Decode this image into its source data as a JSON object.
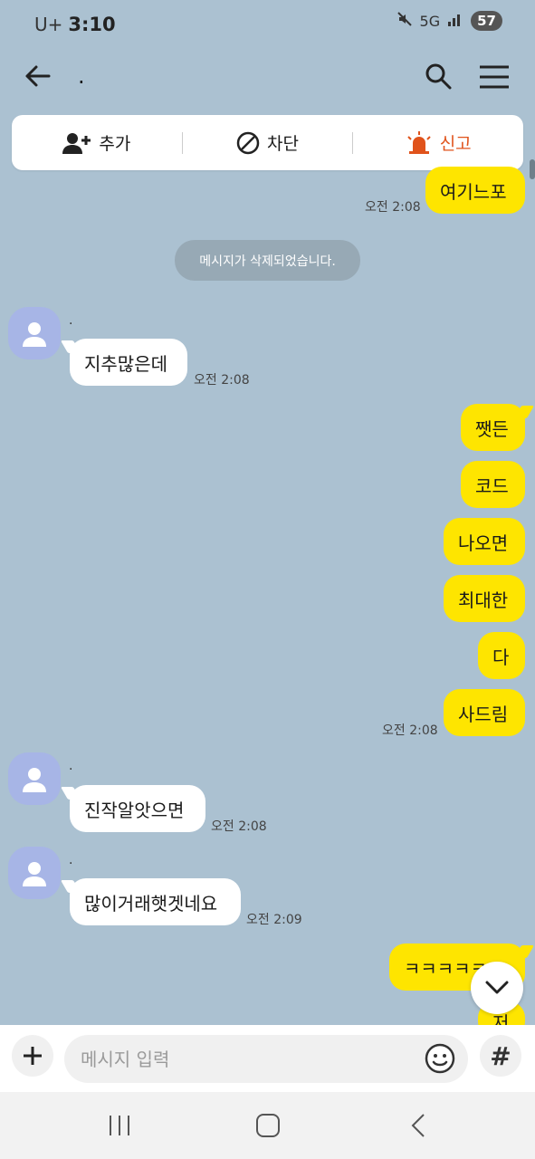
{
  "status_bar": {
    "carrier": "U+",
    "time": "3:10",
    "network": "5G",
    "battery": "57"
  },
  "header": {
    "title": "."
  },
  "actions": {
    "add": "추가",
    "block": "차단",
    "report": "신고"
  },
  "system_message": "메시지가 삭제되었습니다.",
  "messages": [
    {
      "text": "여기느포"
    },
    {
      "time": "오전 2:08"
    },
    {
      "sender": ".",
      "text": "지추많은데",
      "time": "오전 2:08"
    },
    {
      "text": "쨋든"
    },
    {
      "text": "코드"
    },
    {
      "text": "나오면"
    },
    {
      "text": "최대한"
    },
    {
      "text": "다"
    },
    {
      "text": "사드림",
      "time": "오전 2:08"
    },
    {
      "sender": ".",
      "text": "진작알앗으면",
      "time": "오전 2:08"
    },
    {
      "sender": ".",
      "text": "많이거래햇겟네요",
      "time": "오전 2:09"
    },
    {
      "text": "ㅋㅋㅋㅋㅋㅋ"
    },
    {
      "text": "저"
    }
  ],
  "input": {
    "placeholder": "메시지 입력"
  },
  "colors": {
    "background": "#abc1d1",
    "my_bubble": "#fee500",
    "their_bubble": "#ffffff",
    "report": "#e0531b",
    "avatar": "#a7b5e6"
  }
}
